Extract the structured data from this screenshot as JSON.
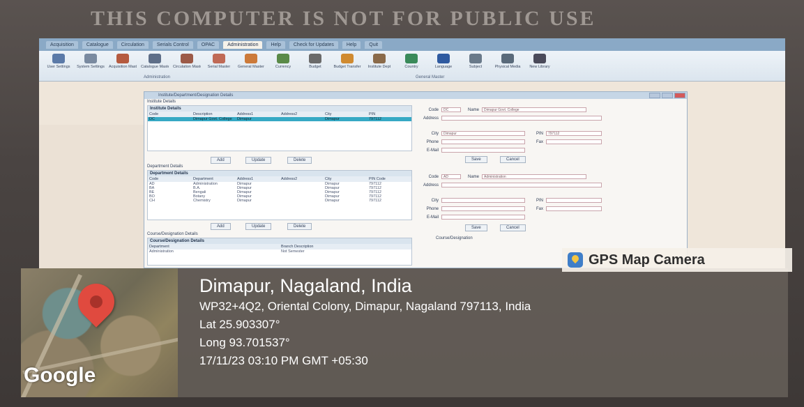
{
  "sticker_text": "THIS COMPUTER IS NOT FOR PUBLIC USE",
  "ribbon": {
    "tabs": [
      "Acquisition",
      "Catalogue",
      "Circulation",
      "Serials Control",
      "OPAC",
      "Administration",
      "Help",
      "Check for Updates",
      "Help",
      "Quit"
    ],
    "active_tab": "Administration",
    "buttons": [
      {
        "label": "User Settings",
        "icon": "users-icon",
        "color": "#5b7aa8"
      },
      {
        "label": "System Settings",
        "icon": "tools-icon",
        "color": "#7a8aa0"
      },
      {
        "label": "Acquisition Master",
        "icon": "cart-icon",
        "color": "#b55a3f"
      },
      {
        "label": "Catalogue Master",
        "icon": "catalogue-icon",
        "color": "#5e6e88"
      },
      {
        "label": "Circulation Master",
        "icon": "circulation-icon",
        "color": "#9c5a48"
      },
      {
        "label": "Serial Master",
        "icon": "serial-icon",
        "color": "#c06a56"
      },
      {
        "label": "General Master",
        "icon": "house-icon",
        "color": "#cc7a3a"
      },
      {
        "label": "Currency",
        "icon": "currency-icon",
        "color": "#5a8a48"
      },
      {
        "label": "Budget",
        "icon": "budget-icon",
        "color": "#6a6a6a"
      },
      {
        "label": "Budget Transfer",
        "icon": "transfer-icon",
        "color": "#d08a30"
      },
      {
        "label": "Institute Dept",
        "icon": "institute-icon",
        "color": "#8a6a4a"
      },
      {
        "label": "Country",
        "icon": "globe-icon",
        "color": "#3a8a5a"
      },
      {
        "label": "Language",
        "icon": "language-icon",
        "color": "#2f5aa0"
      },
      {
        "label": "Subject",
        "icon": "subject-icon",
        "color": "#6a7a8a"
      },
      {
        "label": "Physical Media",
        "icon": "media-icon",
        "color": "#5a6a7a"
      },
      {
        "label": "New Library",
        "icon": "library-icon",
        "color": "#4a4a5a"
      }
    ],
    "group_admin": "Administration",
    "group_general": "General Master"
  },
  "form": {
    "title": "Institute/Department/Designation Details",
    "institute_section": "Institute Details",
    "institute_panel": "Institute Details",
    "institute_cols": [
      "Code",
      "Description",
      "Address1",
      "Address2",
      "City",
      "PIN"
    ],
    "institute_row": [
      "DC",
      "Dimapur Govt. College",
      "Dimapur",
      "",
      "Dimapur",
      "797112"
    ],
    "dept_section": "Department Details",
    "dept_panel": "Department Details",
    "dept_cols": [
      "Code",
      "Department",
      "Address1",
      "Address2",
      "City",
      "PIN Code"
    ],
    "dept_rows": [
      [
        "AD",
        "Administration",
        "Dimapur",
        "",
        "Dimapur",
        "797112"
      ],
      [
        "BA",
        "B.A.",
        "Dimapur",
        "",
        "Dimapur",
        "797112"
      ],
      [
        "BE",
        "Bengali",
        "Dimapur",
        "",
        "Dimapur",
        "797112"
      ],
      [
        "BO",
        "Botany",
        "Dimapur",
        "",
        "Dimapur",
        "797112"
      ],
      [
        "CH",
        "Chemistry",
        "Dimapur",
        "",
        "Dimapur",
        "797112"
      ]
    ],
    "course_section": "Course/Designation Details",
    "course_panel": "Course/Designation Details",
    "course_cols": [
      "Department",
      "Branch Description"
    ],
    "course_rows": [
      [
        "Administration",
        "Not Semester"
      ]
    ],
    "btn_add": "Add",
    "btn_update": "Update",
    "btn_delete": "Delete",
    "btn_save": "Save",
    "btn_cancel": "Cancel",
    "inst_form": {
      "code_label": "Code",
      "name_label": "Name",
      "address_label": "Address",
      "city_label": "City",
      "pin_label": "PIN",
      "phone_label": "Phone",
      "fax_label": "Fax",
      "email_label": "E-Mail",
      "code": "DC",
      "name": "Dimapur Govt. College",
      "city": "Dimapur",
      "pin": "797112"
    },
    "dept_form": {
      "code_label": "Code",
      "name_label": "Name",
      "address_label": "Address",
      "city_label": "City",
      "pin_label": "PIN",
      "phone_label": "Phone",
      "fax_label": "Fax",
      "email_label": "E-Mail",
      "code": "AD",
      "name": "Administration"
    },
    "course_label": "Course/Designation"
  },
  "gps": {
    "app_name": "GPS Map Camera",
    "city": "Dimapur, Nagaland, India",
    "address": "WP32+4Q2, Oriental Colony, Dimapur, Nagaland 797113, India",
    "lat": "Lat 25.903307°",
    "long": "Long 93.701537°",
    "datetime": "17/11/23 03:10 PM GMT +05:30",
    "map_brand": "Google"
  }
}
